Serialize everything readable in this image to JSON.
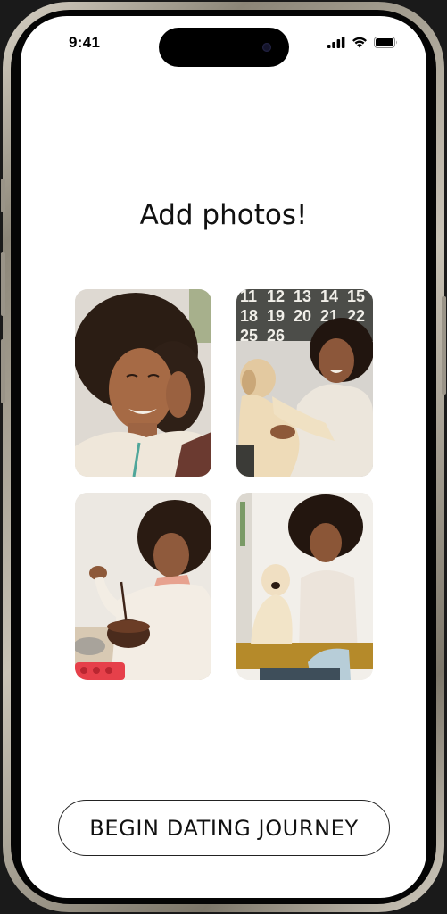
{
  "status_bar": {
    "time": "9:41",
    "icons": [
      "signal-icon",
      "wifi-icon",
      "battery-icon"
    ]
  },
  "page": {
    "title": "Add photos!"
  },
  "photos": [
    {
      "name": "photo-portrait-hand-on-head"
    },
    {
      "name": "photo-with-dog-calendar"
    },
    {
      "name": "photo-baking-chocolate"
    },
    {
      "name": "photo-with-dog-seated"
    }
  ],
  "calendar_numbers": [
    "11",
    "12",
    "13",
    "14",
    "15",
    "18",
    "19",
    "20",
    "21",
    "22",
    "25",
    "26"
  ],
  "cta": {
    "label": "BEGIN DATING JOURNEY"
  },
  "colors": {
    "screen_bg": "#ffffff",
    "text": "#111111",
    "button_border": "#222222"
  }
}
